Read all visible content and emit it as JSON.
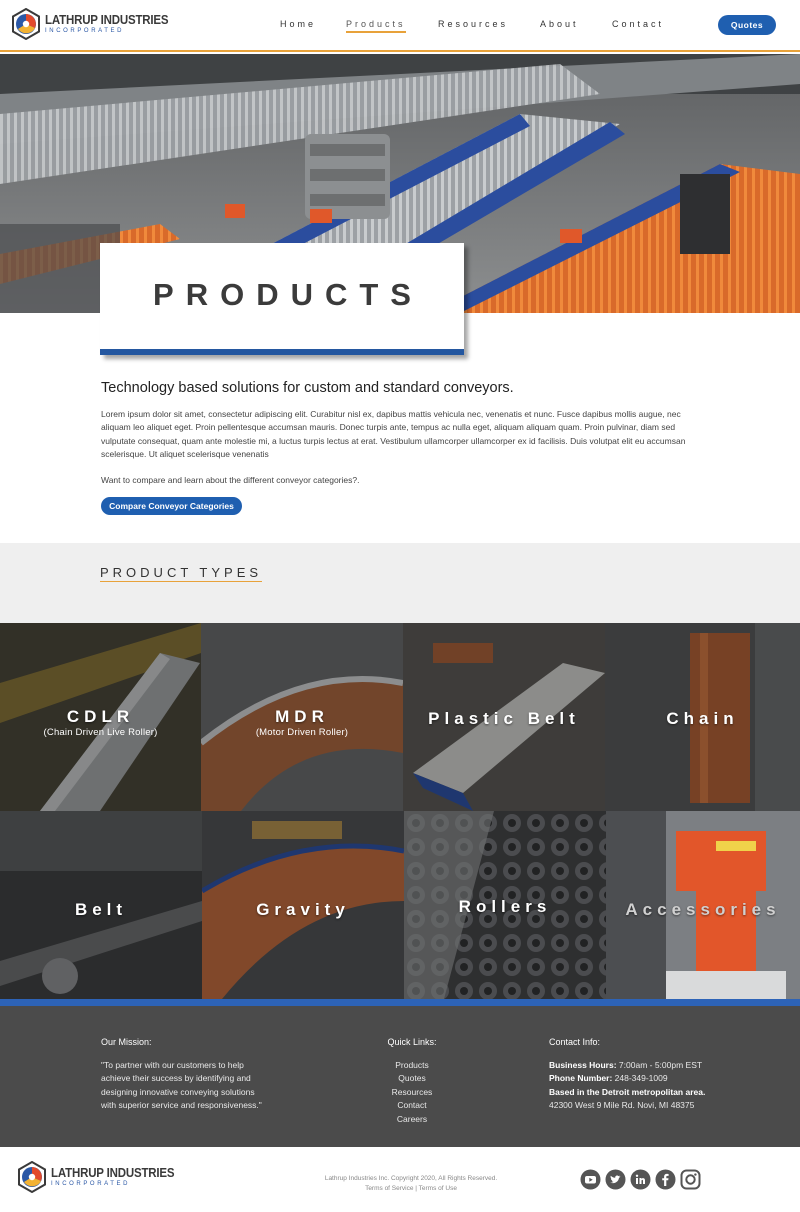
{
  "brand": {
    "name": "LATHRUP INDUSTRIES",
    "sub": "INCORPORATED"
  },
  "nav": {
    "items": [
      "Home",
      "Products",
      "Resources",
      "About",
      "Contact"
    ],
    "active": "Products",
    "quotes_label": "Quotes"
  },
  "hero": {
    "title": "PRODUCTS"
  },
  "intro": {
    "heading": "Technology based solutions  for custom and standard conveyors.",
    "body": "Lorem ipsum dolor sit amet, consectetur adipiscing elit. Curabitur nisl ex, dapibus mattis vehicula nec, venenatis et nunc. Fusce dapibus mollis augue, nec aliquam leo aliquet eget. Proin pellentesque accumsan mauris. Donec turpis ante, tempus ac nulla eget, aliquam aliquam quam. Proin pulvinar, diam sed vulputate consequat, quam ante molestie mi, a luctus turpis lectus at erat. Vestibulum ullamcorper ullamcorper ex id facilisis. Duis volutpat elit eu accumsan scelerisque. Ut aliquet scelerisque venenatis",
    "cta_text": "Want to compare and learn about the different conveyor categories?.",
    "cta_button": "Compare Conveyor Categories"
  },
  "product_types": {
    "heading": "PRODUCT TYPES",
    "tiles": [
      {
        "label": "CDLR",
        "sub": "(Chain Driven Live Roller)"
      },
      {
        "label": "MDR",
        "sub": "(Motor Driven Roller)"
      },
      {
        "label": "Plastic Belt",
        "sub": ""
      },
      {
        "label": "Chain",
        "sub": ""
      },
      {
        "label": "Belt",
        "sub": ""
      },
      {
        "label": "Gravity",
        "sub": ""
      },
      {
        "label": "Rollers",
        "sub": ""
      },
      {
        "label": "Accessories",
        "sub": ""
      }
    ]
  },
  "footer": {
    "mission_title": "Our Mission:",
    "mission_text": "\"To partner with our customers to help achieve their success by identifying and designing innovative conveying solutions with superior service and responsiveness.\"",
    "links_title": "Quick Links:",
    "links": [
      "Products",
      "Quotes",
      "Resources",
      "Contact",
      "Careers"
    ],
    "contact_title": "Contact Info:",
    "hours_label": "Business Hours:",
    "hours_value": "7:00am - 5:00pm EST",
    "phone_label": "Phone Number:",
    "phone_value": "248-349-1009",
    "based": "Based in the Detroit metropolitan area.",
    "address": "42300 West 9 Mile Rd. Novi, MI 48375"
  },
  "bottom": {
    "copyright": "Lathrup Industries Inc. Copyright 2020, All Rights Reserved.",
    "terms": "Terms of Service | Terms of Use"
  },
  "social_icons": [
    "youtube-icon",
    "twitter-icon",
    "linkedin-icon",
    "facebook-icon",
    "instagram-icon"
  ],
  "colors": {
    "accent": "#e8a23a",
    "primary": "#1f5fb0",
    "footer_bg": "#4b4b4b"
  }
}
